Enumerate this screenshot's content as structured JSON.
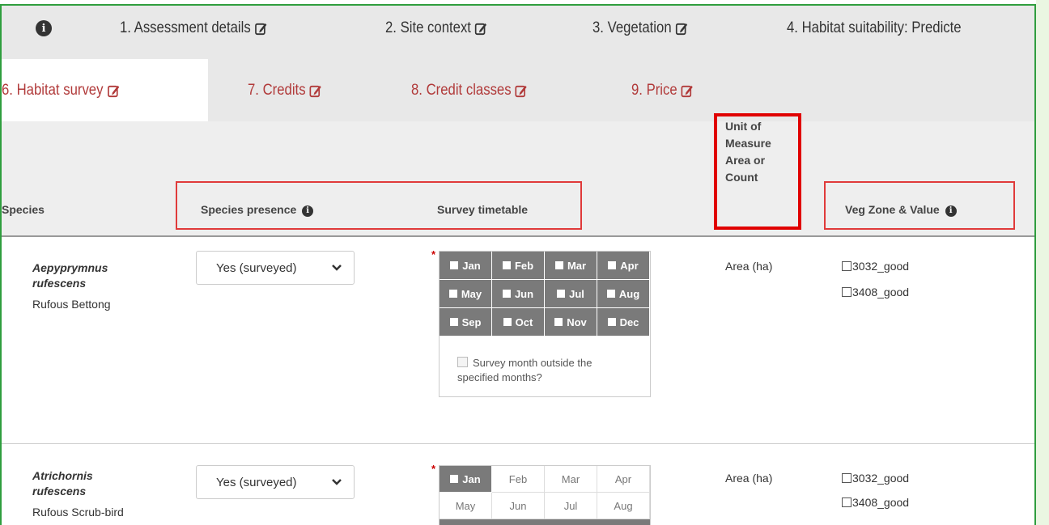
{
  "tabs_row1": [
    {
      "label": "1. Assessment details"
    },
    {
      "label": "2. Site context"
    },
    {
      "label": "3. Vegetation"
    },
    {
      "label": "4. Habitat suitability: Predicte"
    }
  ],
  "tabs_row2": [
    {
      "label": "6. Habitat survey",
      "active": true
    },
    {
      "label": "7. Credits"
    },
    {
      "label": "8. Credit classes"
    },
    {
      "label": "9. Price"
    }
  ],
  "table": {
    "headers": {
      "species": "Species",
      "species_presence": "Species presence",
      "survey_timetable": "Survey timetable",
      "unit_of_measure": [
        "Unit of",
        "Measure",
        "Area or",
        "Count"
      ],
      "veg_zone": "Veg Zone & Value"
    },
    "rows": [
      {
        "latin": [
          "Aepyprymnus",
          "rufescens"
        ],
        "common": "Rufous Bettong",
        "presence": "Yes (surveyed)",
        "months": [
          "Jan",
          "Feb",
          "Mar",
          "Apr",
          "May",
          "Jun",
          "Jul",
          "Aug",
          "Sep",
          "Oct",
          "Nov",
          "Dec"
        ],
        "outside_label": "Survey month outside the specified months?",
        "unit": "Area (ha)",
        "veg_zones": [
          "3032_good",
          "3408_good"
        ]
      },
      {
        "latin": [
          "Atrichornis",
          "rufescens"
        ],
        "common": "Rufous Scrub-bird",
        "presence": "Yes (surveyed)",
        "months": [
          "Jan",
          "Feb",
          "Mar",
          "Apr",
          "May",
          "Jun",
          "Jul",
          "Aug"
        ],
        "unit": "Area (ha)",
        "veg_zones": [
          "3032_good",
          "3408_good"
        ]
      }
    ]
  },
  "colors": {
    "frame": "#2f9e3e",
    "tab_inactive_text": "#b13a3a",
    "highlight": "#e00000",
    "month_fill": "#7a7a7a"
  },
  "icons": {
    "info": "info-circle-icon",
    "edit": "edit-icon",
    "chevron": "chevron-down-icon",
    "required": "required-asterisk"
  }
}
